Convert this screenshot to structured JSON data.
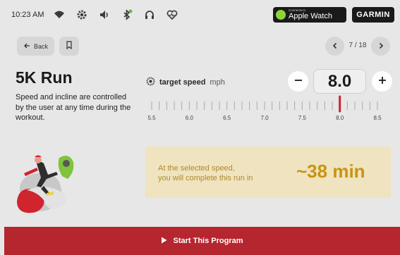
{
  "status_bar": {
    "time": "10:23 AM",
    "icons": [
      "wifi-icon",
      "gear-icon",
      "volume-icon",
      "bluetooth-icon",
      "headphones-icon",
      "heart-rate-icon"
    ],
    "apple_watch": {
      "small": "Connects to",
      "big": "Apple Watch"
    },
    "garmin": "GARMIN"
  },
  "nav": {
    "back_label": "Back",
    "page_indicator": "7 / 18"
  },
  "program": {
    "title": "5K Run",
    "description": "Speed and incline are controlled by the user at any time during the workout."
  },
  "speed": {
    "label": "target speed",
    "unit": "mph",
    "value": "8.0",
    "scale": {
      "min": 5.5,
      "max": 8.5,
      "tick_step": 0.1,
      "labels": [
        "5.5",
        "6.0",
        "6.5",
        "7.0",
        "7.5",
        "8.0",
        "8.5"
      ],
      "marker": 8.0,
      "marker_color": "#c4262f"
    }
  },
  "estimate": {
    "text_line1": "At the selected speed,",
    "text_line2": "you will complete this run in",
    "time": "~38 min"
  },
  "cta": {
    "label": "Start This Program"
  },
  "colors": {
    "accent_red": "#b5262f",
    "estimate_bg": "#efe3c0",
    "estimate_text": "#c9940f",
    "apple_green": "#8cd43a"
  }
}
